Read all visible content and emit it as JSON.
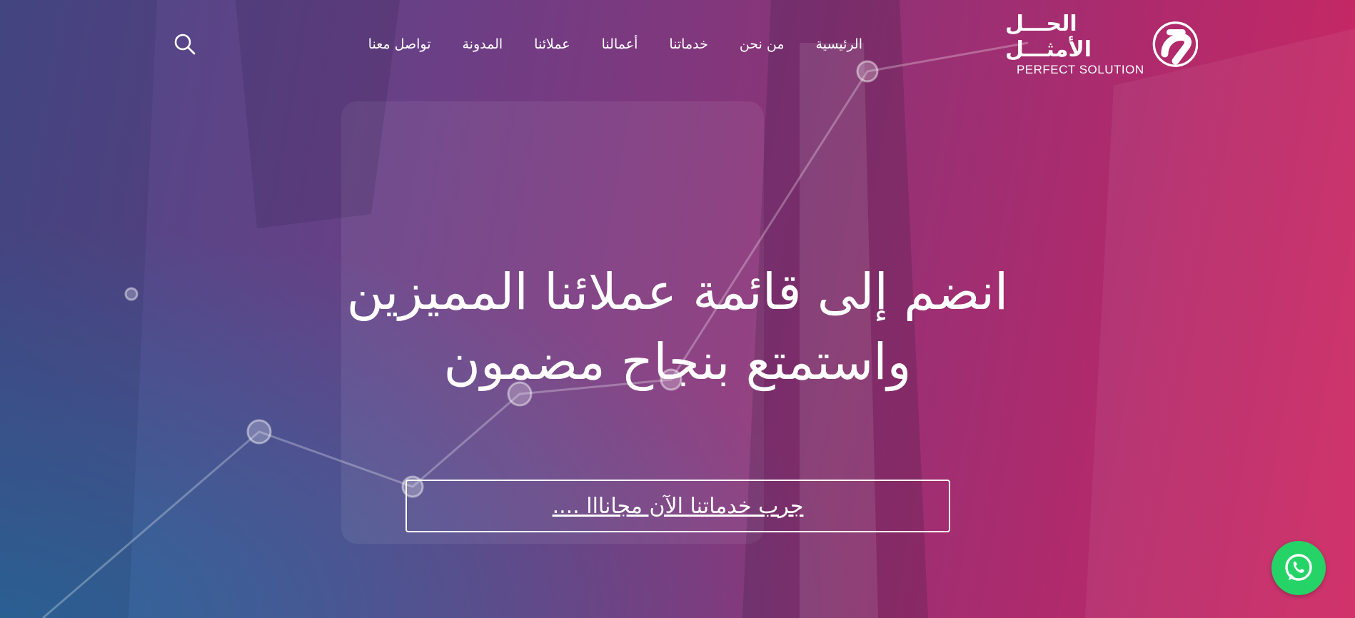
{
  "logo": {
    "arabic": "الحـــل الأمثـــل",
    "english": "PERFECT SOLUTION"
  },
  "nav": {
    "items": [
      {
        "label": "الرئيسية"
      },
      {
        "label": "من نحن"
      },
      {
        "label": "خدماتنا"
      },
      {
        "label": "أعمالنا"
      },
      {
        "label": "عملائنا"
      },
      {
        "label": "المدونة"
      },
      {
        "label": "تواصل معنا"
      }
    ]
  },
  "hero": {
    "headline_line1": "انضم إلى قائمة عملائنا المميزين",
    "headline_line2": "واستمتع بنجاح مضمون",
    "cta_label": "جرب خدماتنا الآن مجانااا ...."
  },
  "icons": {
    "search": "search-icon",
    "whatsapp": "whatsapp-icon"
  },
  "colors": {
    "gradient_left": "#4a4a88",
    "gradient_right": "#cf2761",
    "whatsapp": "#25d366"
  }
}
